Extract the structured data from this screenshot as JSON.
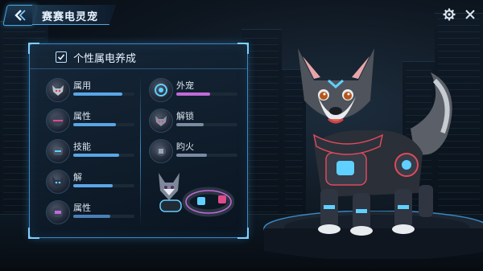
{
  "header": {
    "title": "赛赛电灵宠"
  },
  "panel": {
    "title": "个性属电养成"
  },
  "traits_left": [
    {
      "label": "属用",
      "progress": 0.8,
      "color": "#5aa6e6",
      "icon": "wolf-head-icon"
    },
    {
      "label": "属性",
      "progress": 0.7,
      "color": "#5aa6e6",
      "icon": "armor-helmet-icon"
    },
    {
      "label": "技能",
      "progress": 0.75,
      "color": "#5aa6e6",
      "icon": "robot-head-icon"
    },
    {
      "label": "解",
      "progress": 0.65,
      "color": "#5aa6e6",
      "icon": "cat-face-icon"
    },
    {
      "label": "属性",
      "progress": 0.6,
      "color": "#4a7fb5",
      "icon": "armor-chest-icon"
    }
  ],
  "traits_right": [
    {
      "label": "外宠",
      "progress": 0.55,
      "color": "#c06bd8",
      "icon": "tech-core-icon"
    },
    {
      "label": "解锁",
      "progress": 0.45,
      "color": "#7a8aa0",
      "icon": "wolf-mask-icon"
    },
    {
      "label": "盷火",
      "progress": 0.5,
      "color": "#7a8aa0",
      "icon": "gear-badge-icon"
    }
  ],
  "colors": {
    "accent": "#3b87c0",
    "glow": "#7fd0ff",
    "purple": "#c06bd8"
  }
}
